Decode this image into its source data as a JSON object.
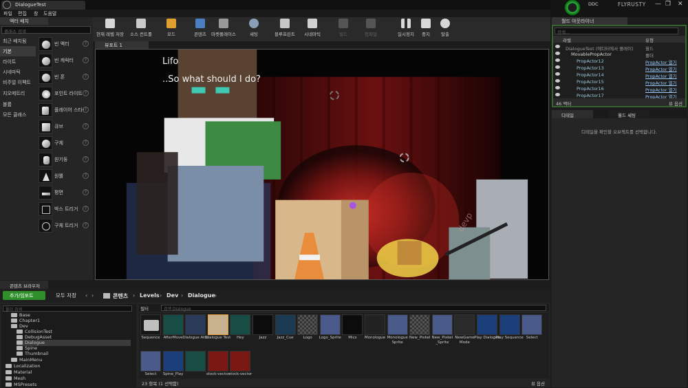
{
  "window": {
    "tab_title": "DialogueTest",
    "ddc_label": "DDC",
    "project_name": "FLYRUSTY",
    "minimize": "—",
    "maximize": "❐",
    "close": "✕"
  },
  "menu": [
    "파일",
    "편집",
    "창",
    "도움말"
  ],
  "left_panel": {
    "tab": "액터 배치",
    "search_placeholder": "클래스 검색",
    "categories": [
      {
        "label": "최근 배치됨",
        "selected": false
      },
      {
        "label": "기본",
        "selected": true
      },
      {
        "label": "라이트",
        "selected": false
      },
      {
        "label": "시네마틱",
        "selected": false
      },
      {
        "label": "비주얼 이펙트",
        "selected": false
      },
      {
        "label": "지오메트리",
        "selected": false
      },
      {
        "label": "볼륨",
        "selected": false
      },
      {
        "label": "모든 클래스",
        "selected": false
      }
    ],
    "actors": [
      {
        "label": "빈 액터",
        "icon": "sphere-icon"
      },
      {
        "label": "빈 캐릭터",
        "icon": "character-icon"
      },
      {
        "label": "빈 폰",
        "icon": "pawn-icon"
      },
      {
        "label": "포인트 라이트",
        "icon": "point-light-icon"
      },
      {
        "label": "플레이어 스타!",
        "icon": "player-start-icon"
      },
      {
        "label": "큐브",
        "icon": "cube-icon"
      },
      {
        "label": "구체",
        "icon": "sphere-icon"
      },
      {
        "label": "원기둥",
        "icon": "cylinder-icon"
      },
      {
        "label": "원뿔",
        "icon": "cone-icon"
      },
      {
        "label": "평면",
        "icon": "plane-icon"
      },
      {
        "label": "박스 트리거",
        "icon": "box-trigger-icon"
      },
      {
        "label": "구체 트리거",
        "icon": "sphere-trigger-icon"
      }
    ]
  },
  "toolbar": {
    "buttons": [
      {
        "label": "현재 레벨 저장",
        "icon": "save-icon",
        "color": "#d6d6d6"
      },
      {
        "label": "소스 컨트롤",
        "icon": "source-control-icon",
        "color": "#c9c9c9"
      },
      {
        "label": "모드",
        "icon": "modes-icon",
        "color": "#e0a030"
      },
      {
        "label": "콘텐츠",
        "icon": "content-icon",
        "color": "#4a7fc0"
      },
      {
        "label": "마켓플레이스",
        "icon": "marketplace-icon",
        "color": "#9a9a9a"
      },
      {
        "label": "세팅",
        "icon": "settings-icon",
        "color": "#8aa0b8"
      },
      {
        "label": "블루프린트",
        "icon": "blueprint-icon",
        "color": "#c8c8c8"
      },
      {
        "label": "시네마틱",
        "icon": "cinematic-icon",
        "color": "#d0d0d0"
      },
      {
        "label": "빌드",
        "icon": "build-icon",
        "color": "#555555"
      },
      {
        "label": "컴파일",
        "icon": "compile-icon",
        "color": "#555555"
      },
      {
        "label": "일시정지",
        "icon": "pause-icon",
        "color": "#d8d8d8"
      },
      {
        "label": "중지",
        "icon": "stop-icon",
        "color": "#d8d8d8"
      },
      {
        "label": "탈출",
        "icon": "eject-icon",
        "color": "#d8d8d8"
      }
    ]
  },
  "viewport": {
    "tab": "뷰포트 1",
    "dialogue": {
      "speaker": "Lifo",
      "text": "..So what should I do?"
    },
    "watermark": "devp"
  },
  "outliner": {
    "tab": "월드 아웃라이너",
    "search_placeholder": "검색...",
    "col_label": "라벨",
    "col_type": "유형",
    "rows": [
      {
        "name": "DialogueTest (에디터에서 플레이)",
        "type": "월드",
        "link": false,
        "indent": 1
      },
      {
        "name": "MovablePropActor",
        "type": "폴더",
        "link": false,
        "indent": 2
      },
      {
        "name": "PropActor12",
        "type": "PropActor 열기",
        "link": true,
        "indent": 3
      },
      {
        "name": "PropActor13",
        "type": "PropActor 열기",
        "link": true,
        "indent": 3
      },
      {
        "name": "PropActor14",
        "type": "PropActor 열기",
        "link": true,
        "indent": 3
      },
      {
        "name": "PropActor15",
        "type": "PropActor 열기",
        "link": true,
        "indent": 3
      },
      {
        "name": "PropActor16",
        "type": "PropActor 열기",
        "link": true,
        "indent": 3
      },
      {
        "name": "PropActor17",
        "type": "PropActor 열기",
        "link": true,
        "indent": 3
      }
    ],
    "count": "46 액터",
    "view_options": "뷰 옵션"
  },
  "details": {
    "tab": "디테일",
    "tab2": "월드 세팅",
    "message": "디테일을 확인할 오브젝트를 선택합니다."
  },
  "content_browser": {
    "tab": "콘텐츠 브라우저",
    "add_import": "추가/임포트",
    "save_all": "모두 저장",
    "breadcrumb": [
      "콘텐츠",
      "Levels",
      "Dev",
      "Dialogue"
    ],
    "tree_search_placeholder": "폴더 검색",
    "tree": [
      {
        "label": "Base",
        "indent": 1,
        "selected": false
      },
      {
        "label": "Chapter1",
        "indent": 1,
        "selected": false
      },
      {
        "label": "Dev",
        "indent": 1,
        "selected": false
      },
      {
        "label": "CollisionTest",
        "indent": 2,
        "selected": false
      },
      {
        "label": "DebugAsset",
        "indent": 2,
        "selected": false
      },
      {
        "label": "Dialogue",
        "indent": 2,
        "selected": true
      },
      {
        "label": "Spine",
        "indent": 2,
        "selected": false
      },
      {
        "label": "Thumbnail",
        "indent": 2,
        "selected": false
      },
      {
        "label": "MainMenu",
        "indent": 1,
        "selected": false
      },
      {
        "label": "Localization",
        "indent": 0,
        "selected": false
      },
      {
        "label": "Material",
        "indent": 0,
        "selected": false
      },
      {
        "label": "Mesh",
        "indent": 0,
        "selected": false
      },
      {
        "label": "MSPresets",
        "indent": 0,
        "selected": false
      }
    ],
    "filter_label": "필터",
    "asset_search_placeholder": "검색 Dialogue",
    "assets": [
      {
        "name": "Sequence",
        "kind": "folder"
      },
      {
        "name": "AfterMove",
        "kind": "teal"
      },
      {
        "name": "Dialogue Attu",
        "kind": "sprite"
      },
      {
        "name": "Dialogue Test",
        "kind": "level",
        "selected": true
      },
      {
        "name": "Hey",
        "kind": "teal"
      },
      {
        "name": "Jazz",
        "kind": "wave"
      },
      {
        "name": "Jazz_Cue",
        "kind": "cue"
      },
      {
        "name": "Logo",
        "kind": "checker"
      },
      {
        "name": "Logo_Sprite",
        "kind": "sprite2"
      },
      {
        "name": "Mics",
        "kind": "wave"
      },
      {
        "name": "Monologue",
        "kind": "dark"
      },
      {
        "name": "Monologue Sprite",
        "kind": "sprite2"
      },
      {
        "name": "New_Pixkel",
        "kind": "checker"
      },
      {
        "name": "New_Pixkel _Sprite",
        "kind": "sprite2"
      },
      {
        "name": "NewGame Mode",
        "kind": "gamemode"
      },
      {
        "name": "Play Dialogue",
        "kind": "blue"
      },
      {
        "name": "Play Sequence",
        "kind": "blue"
      },
      {
        "name": "Select",
        "kind": "sprite2"
      },
      {
        "name": "Select",
        "kind": "sprite2"
      },
      {
        "name": "Spine_Play",
        "kind": "blue"
      },
      {
        "name": "",
        "kind": "teal"
      },
      {
        "name": "stock-vector",
        "kind": "red"
      },
      {
        "name": "stock-vector",
        "kind": "red"
      }
    ],
    "footer_count": "23 항목 (1 선택함)",
    "view_options": "뷰 옵션"
  }
}
